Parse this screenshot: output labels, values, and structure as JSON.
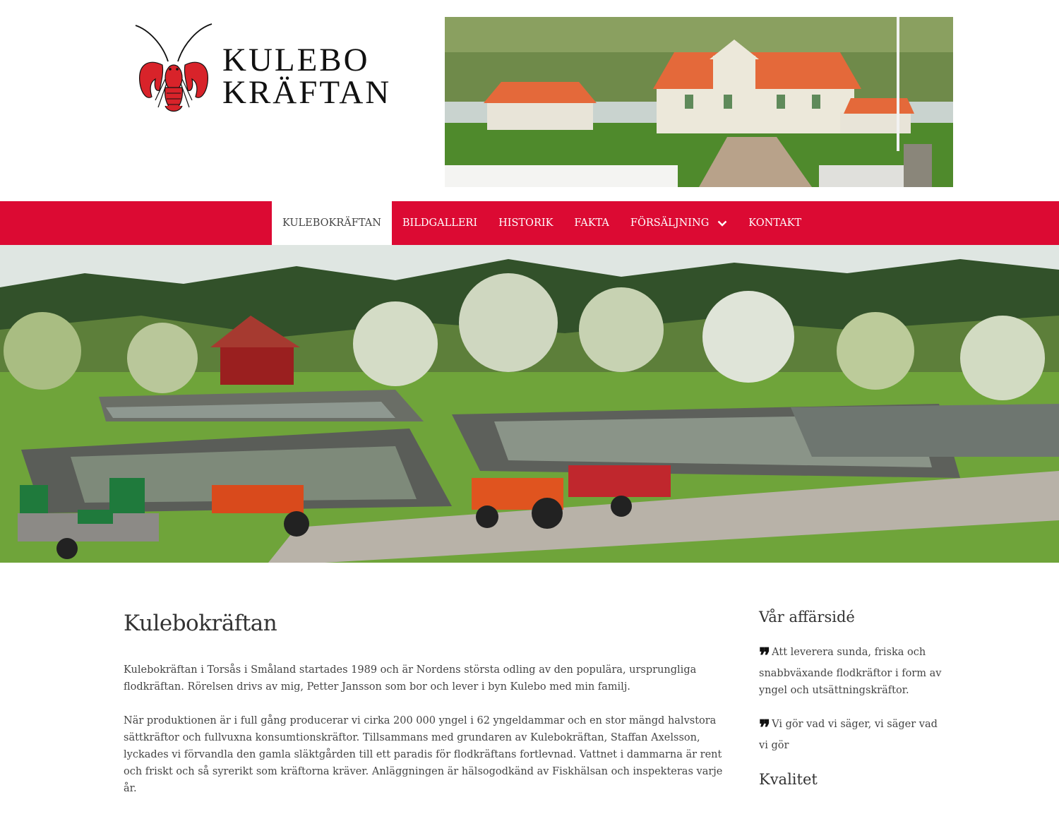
{
  "header": {
    "logo_line1": "KULEBO",
    "logo_line2": "KRÄFTAN"
  },
  "nav": {
    "items": [
      {
        "label": "KULEBOKRÄFTAN",
        "active": true
      },
      {
        "label": "BILDGALLERI"
      },
      {
        "label": "HISTORIK"
      },
      {
        "label": "FAKTA"
      },
      {
        "label": "FÖRSÄLJNING",
        "has_dropdown": true
      },
      {
        "label": "KONTAKT"
      }
    ]
  },
  "main": {
    "title": "Kulebokräftan",
    "paragraphs": [
      "Kulebokräftan i Torsås i Småland startades 1989 och är Nordens största odling av den populära, ursprungliga flodkräftan. Rörelsen drivs av mig, Petter Jansson som bor och lever i byn Kulebo med min familj.",
      "När produktionen är i full gång producerar vi cirka 200 000 yngel i 62 yngeldammar och en stor mängd halvstora sättkräftor och fullvuxna konsumtionskräftor. Tillsammans med grundaren av Kulebokräftan, Staffan Axelsson, lyckades vi förvandla den gamla släktgården till ett paradis för flodkräftans fortlevnad. Vattnet i dammarna är rent och friskt och så syrerikt som kräftorna kräver. Anläggningen är hälsogodkänd av Fiskhälsan och inspekteras varje år."
    ]
  },
  "aside": {
    "heading1": "Vår affärsidé",
    "quotes": [
      "Att leverera sunda, friska och snabbväxande flodkräftor i form av yngel och utsättningskräftor.",
      "Vi gör vad vi säger, vi säger vad vi gör"
    ],
    "heading2": "Kvalitet"
  },
  "colors": {
    "nav_red": "#dc0a33",
    "crayfish_red": "#d8232a"
  },
  "icons": {
    "logo": "crayfish-icon",
    "quote": "quote-icon",
    "dropdown": "chevron-down-icon"
  }
}
